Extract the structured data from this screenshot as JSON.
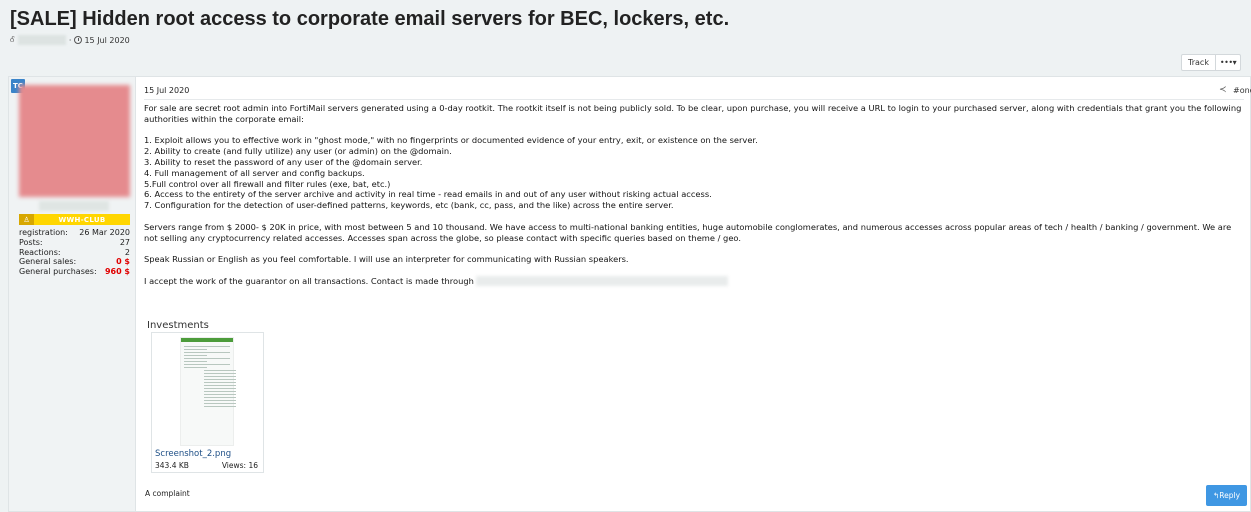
{
  "thread": {
    "title": "[SALE] Hidden root access to corporate email servers for BEC, lockers, etc.",
    "author_initial": "Ꮄ",
    "date": "15 Jul 2020"
  },
  "actions": {
    "track_label": "Track",
    "more_label": "•••▾"
  },
  "sidebar": {
    "avatar_initials": "TC",
    "group": {
      "icon": "user-icon",
      "icon_glyph": "♙",
      "label": "WWH-CLUB"
    },
    "stats": [
      {
        "label": "registration:",
        "value": "26 Mar 2020"
      },
      {
        "label": "Posts:",
        "value": "27"
      },
      {
        "label": "Reactions:",
        "value": "2"
      },
      {
        "label": "General sales:",
        "value": "0 $"
      },
      {
        "label": "General purchases:",
        "value": "960 $"
      }
    ]
  },
  "post": {
    "date": "15 Jul 2020",
    "share_icon": "share-icon",
    "share_glyph": "≺",
    "number": "#one",
    "intro": "For sale are secret root admin into FortiMail servers generated using a 0-day rootkit. The rootkit itself is not being publicly sold. To be clear, upon purchase, you will receive a URL to login to your purchased server, along with credentials that grant you the following authorities within the corporate email:",
    "list": [
      "1. Exploit allows you to effective work in \"ghost mode,\" with no fingerprints or documented evidence of your entry, exit, or existence on the server.",
      "2. Ability to create (and fully utilize) any user (or admin) on the @domain.",
      "3. Ability to reset the password of any user of the @domain server.",
      "4. Full management of all server and config backups.",
      "5.Full control over all firewall and filter rules (exe, bat, etc.)",
      "6. Access to the entirety of the server archive and activity in real time - read emails in and out of any user without risking actual access.",
      "7. Configuration for the detection of user-defined patterns, keywords, etc (bank, cc, pass, and the like) across the entire server."
    ],
    "pricing": "Servers range from $ 2000- $ 20K in price, with most between 5 and 10 thousand. We have access to multi-national banking entities, huge automobile conglomerates, and numerous accesses across popular areas of tech / health / banking / government. We are not selling any cryptocurrency related accesses. Accesses span across the globe, so please contact with specific queries based on theme / geo.",
    "language": "Speak Russian or English as you feel comfortable. I will use an interpreter for communicating with Russian speakers.",
    "contact": "I accept the work of the guarantor on all transactions. Contact is made through",
    "attachments_heading": "Investments",
    "attachment": {
      "filename": "Screenshot_2.png",
      "size": "343.4 KB",
      "views": "Views: 16"
    },
    "complaint_label": "A complaint",
    "reply_label": "↰Reply"
  }
}
